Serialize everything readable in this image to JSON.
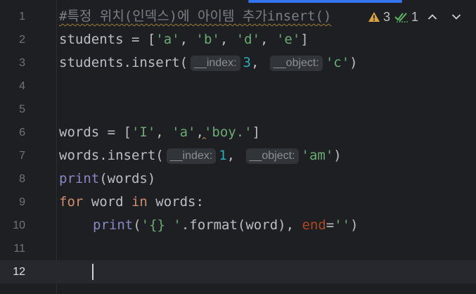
{
  "inspection": {
    "warning_count": "3",
    "typo_count": "1",
    "warning_icon": "warning-triangle-icon",
    "typo_icon": "double-check-icon",
    "prev_icon": "chevron-up-icon",
    "next_icon": "chevron-down-icon"
  },
  "lines": [
    {
      "num": "1",
      "comment": "#특정 위치(인덱스)에 아이템 추가insert()"
    },
    {
      "num": "2",
      "t0": "students = [",
      "s1": "'a'",
      "t1": ", ",
      "s2": "'b'",
      "t2": ", ",
      "s3": "'d'",
      "t3": ", ",
      "s4": "'e'",
      "t4": "]"
    },
    {
      "num": "3",
      "t0": "students.insert(",
      "hint1": "__index:",
      "n1": "3",
      "t1": ", ",
      "hint2": "__object:",
      "s1": "'c'",
      "t2": ")"
    },
    {
      "num": "4"
    },
    {
      "num": "5"
    },
    {
      "num": "6",
      "t0": "words = [",
      "s1": "'I'",
      "t1": ", ",
      "s2": "'a'",
      "t2": ",",
      "s3": "'boy.'",
      "t3": "]"
    },
    {
      "num": "7",
      "t0": "words.insert(",
      "hint1": "__index:",
      "n1": "1",
      "t1": ", ",
      "hint2": "__object:",
      "s1": "'am'",
      "t2": ")"
    },
    {
      "num": "8",
      "b0": "print",
      "t0": "(words)"
    },
    {
      "num": "9",
      "k0": "for",
      "t0": " word ",
      "k1": "in",
      "t1": " words:"
    },
    {
      "num": "10",
      "b0": "print",
      "t0": "(",
      "s1": "'{} '",
      "t1": ".format(word), ",
      "p1": "end",
      "t2": "=",
      "s2": "''",
      "t3": ")"
    },
    {
      "num": "11"
    },
    {
      "num": "12"
    }
  ],
  "colors": {
    "background": "#1e1f22",
    "current_line": "#26282e",
    "keyword": "#cf8e6d",
    "string": "#6aab73",
    "number": "#2aacb8",
    "builtin": "#8888c6",
    "comment": "#7a7e85",
    "named_param": "#aa4926",
    "scroll_accent": "#3574f0"
  }
}
